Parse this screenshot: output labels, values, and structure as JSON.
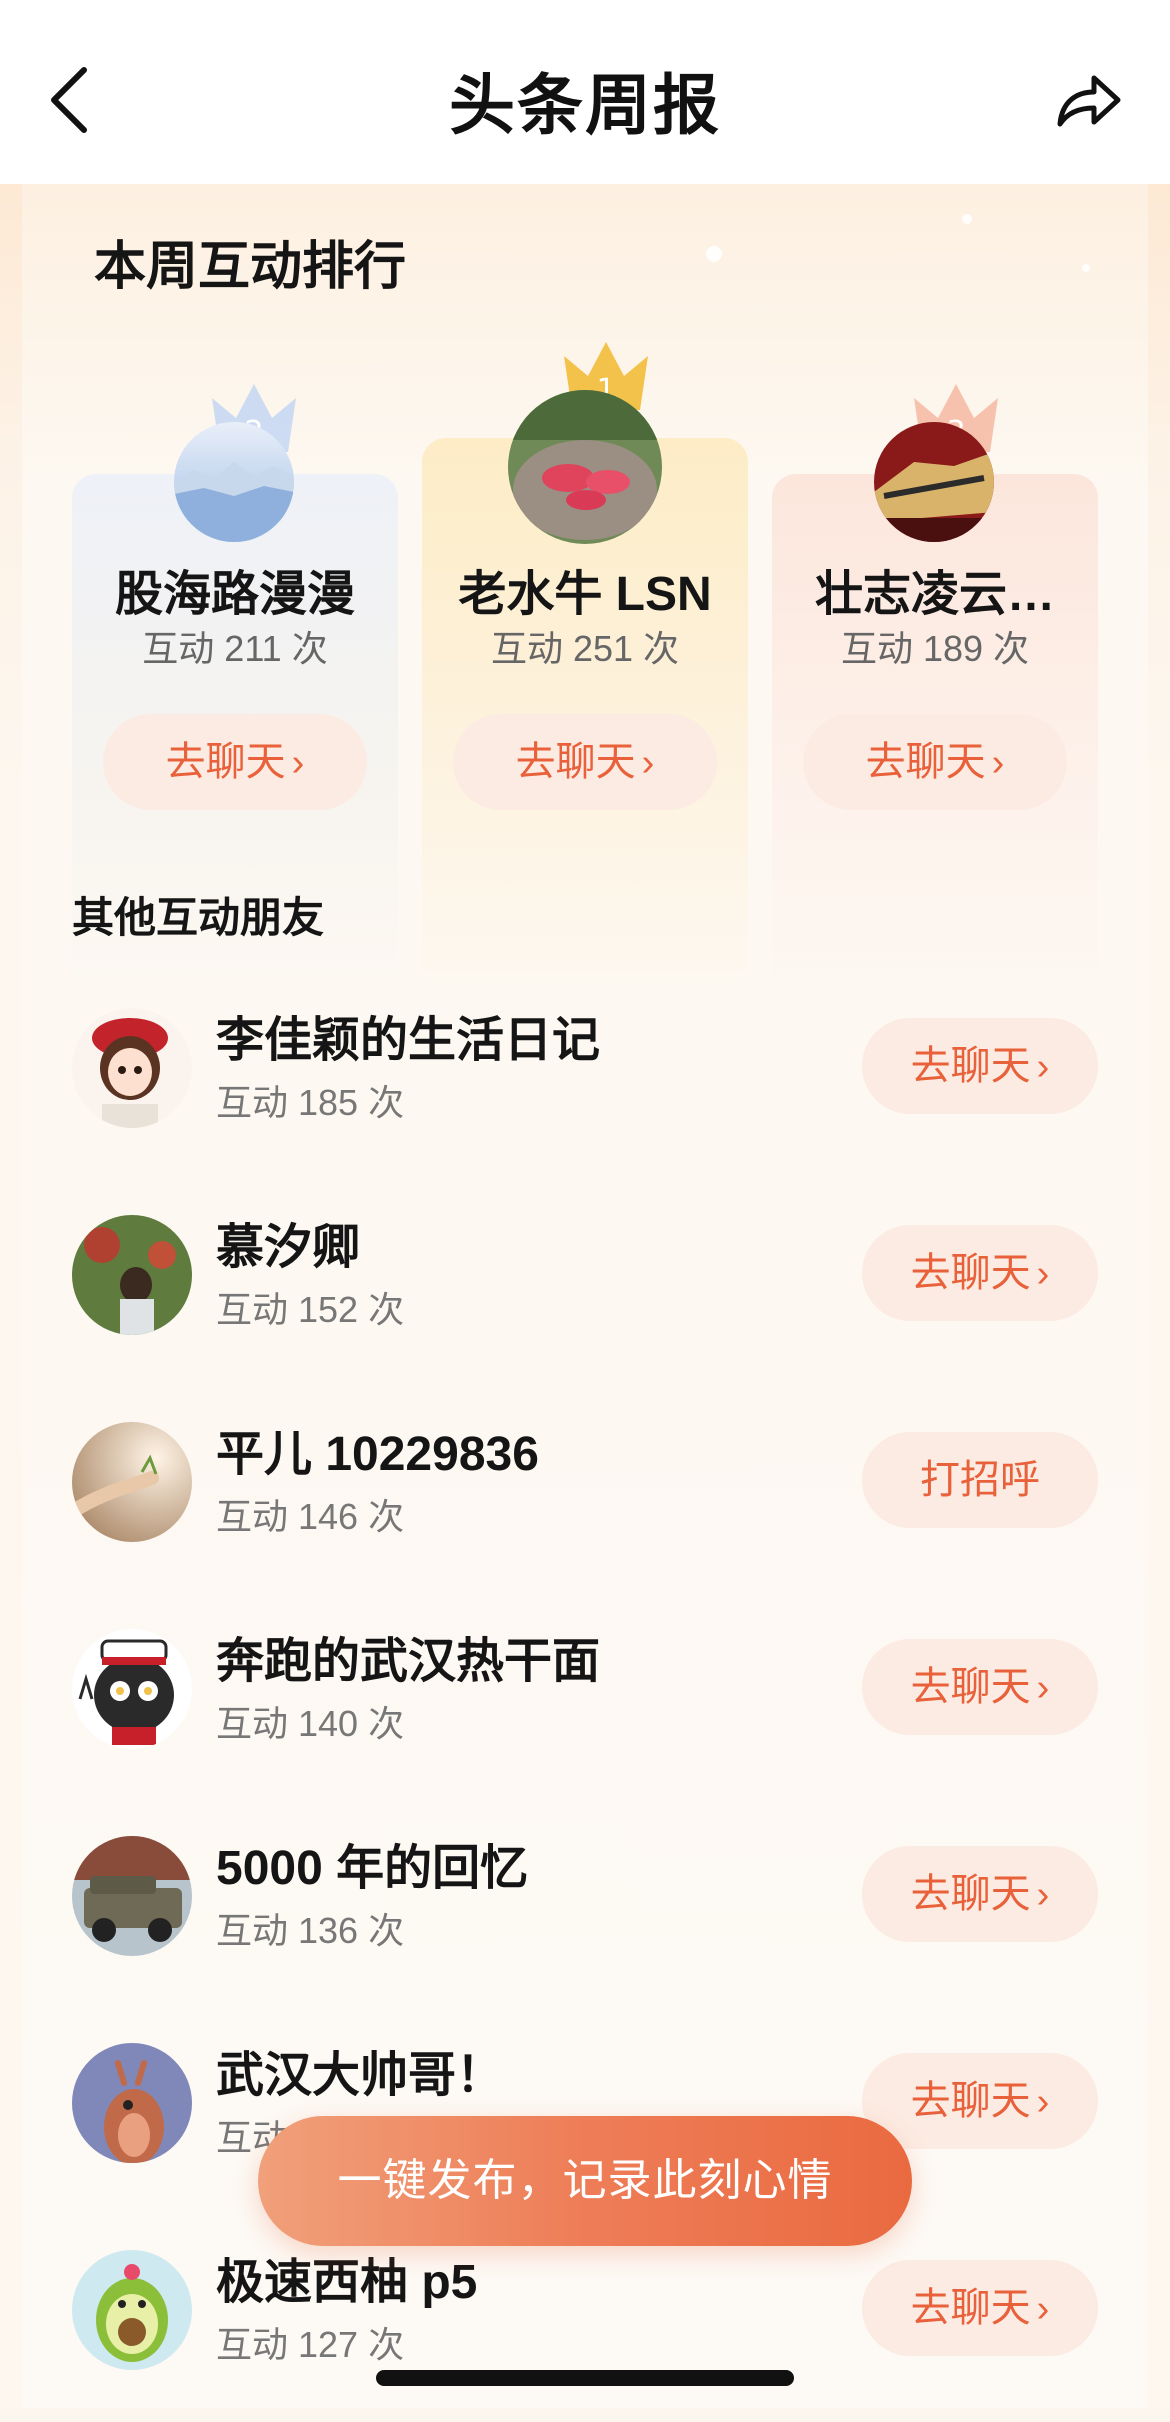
{
  "header": {
    "title": "头条周报"
  },
  "ranking": {
    "title": "本周互动排行",
    "podium": [
      {
        "rank": "2",
        "name": "股海路漫漫",
        "count": "互动 211 次",
        "button": "去聊天"
      },
      {
        "rank": "1",
        "name": "老水牛 LSN",
        "count": "互动 251 次",
        "button": "去聊天"
      },
      {
        "rank": "3",
        "name": "壮志凌云…",
        "count": "互动 189 次",
        "button": "去聊天"
      }
    ]
  },
  "others": {
    "title": "其他互动朋友",
    "items": [
      {
        "name": "李佳颖的生活日记",
        "count": "互动 185 次",
        "button": "去聊天"
      },
      {
        "name": "慕汐卿",
        "count": "互动 152 次",
        "button": "去聊天"
      },
      {
        "name": "平儿 10229836",
        "count": "互动 146 次",
        "button": "打招呼"
      },
      {
        "name": "奔跑的武汉热干面",
        "count": "互动 140 次",
        "button": "去聊天"
      },
      {
        "name": "5000 年的回忆",
        "count": "互动 136 次",
        "button": "去聊天"
      },
      {
        "name": "武汉大帅哥！",
        "count": "互动 13",
        "button": "去聊天"
      },
      {
        "name": "极速西柚 p5",
        "count": "互动 127 次",
        "button": "去聊天"
      }
    ]
  },
  "fab": {
    "label": "一键发布，记录此刻心情"
  },
  "colors": {
    "accent": "#e8613a",
    "button_bg": "#fcebe2",
    "gold": "#f3c24a",
    "silver": "#b9cdee",
    "bronze": "#f5b39a"
  }
}
